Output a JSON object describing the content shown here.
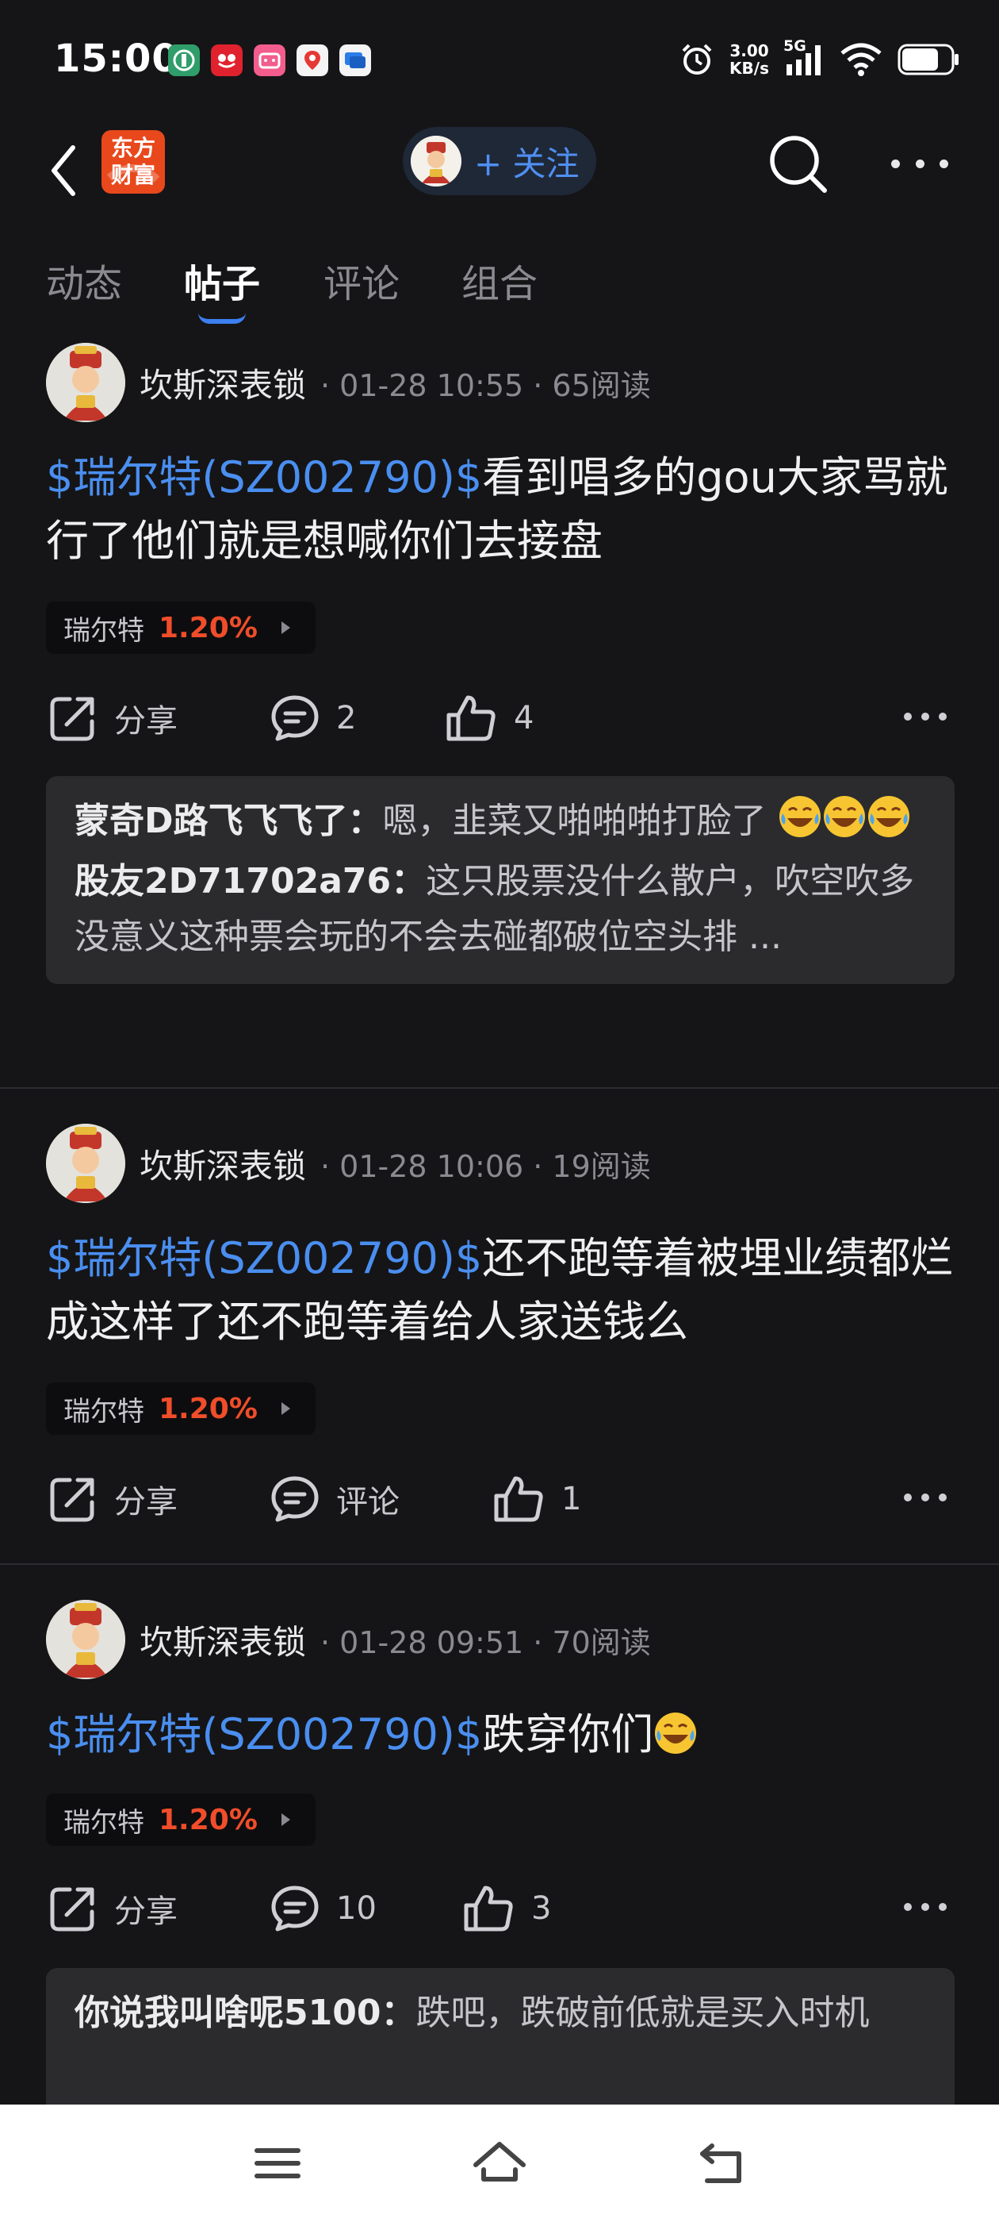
{
  "status_bar": {
    "time": "15:00",
    "net_speed_value": "3.00",
    "net_speed_unit": "KB/s",
    "network": "5G",
    "battery_level": 0.75
  },
  "header": {
    "app_logo": "东方财富",
    "follow_label": "+ 关注"
  },
  "tabs": [
    {
      "label": "动态",
      "active": false
    },
    {
      "label": "帖子",
      "active": true
    },
    {
      "label": "评论",
      "active": false
    },
    {
      "label": "组合",
      "active": false
    }
  ],
  "posts": [
    {
      "author": "坎斯深表锁",
      "meta": "· 01-28 10:55 · 65阅读",
      "stock_link": "$瑞尔特(SZ002790)$",
      "text": "看到唱多的gou大家骂就行了他们就是想喊你们去接盘",
      "stock_tag": {
        "name": "瑞尔特",
        "change": "1.20%"
      },
      "share_label": "分享",
      "comment_label": "2",
      "like_label": "4",
      "comments": [
        {
          "author": "蒙奇D路飞飞飞了",
          "sep": "：",
          "text": "嗯，韭菜又啪啪啪打脸了"
        },
        {
          "author": "股友2D71702a76",
          "sep": "：",
          "text": "这只股票没什么散户，吹空吹多没意义这种票会玩的不会去碰都破位空头排 ..."
        }
      ]
    },
    {
      "author": "坎斯深表锁",
      "meta": "· 01-28 10:06 · 19阅读",
      "stock_link": "$瑞尔特(SZ002790)$",
      "text": "还不跑等着被埋业绩都烂成这样了还不跑等着给人家送钱么",
      "stock_tag": {
        "name": "瑞尔特",
        "change": "1.20%"
      },
      "share_label": "分享",
      "comment_label": "评论",
      "like_label": "1"
    },
    {
      "author": "坎斯深表锁",
      "meta": "· 01-28 09:51 · 70阅读",
      "stock_link": "$瑞尔特(SZ002790)$",
      "text": "跌穿你们",
      "stock_tag": {
        "name": "瑞尔特",
        "change": "1.20%"
      },
      "share_label": "分享",
      "comment_label": "10",
      "like_label": "3",
      "comments": [
        {
          "author": "你说我叫啥呢5100",
          "sep": "：",
          "text": "跌吧，跌破前低就是买入时机"
        }
      ]
    }
  ],
  "colors": {
    "background": "#151517",
    "link_blue": "#4a8ef0",
    "up_red": "#f04d2a",
    "comment_bg": "#2b2b2e"
  }
}
